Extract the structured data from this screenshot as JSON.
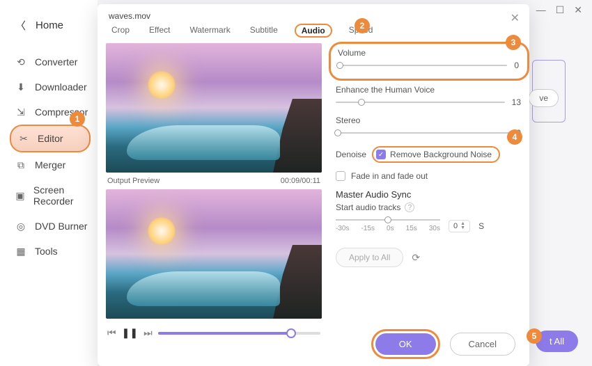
{
  "titlebar": {
    "min": "—",
    "max": "☐",
    "close": "✕"
  },
  "home_label": "Home",
  "sidebar": {
    "items": [
      {
        "label": "Converter"
      },
      {
        "label": "Downloader"
      },
      {
        "label": "Compressor"
      },
      {
        "label": "Editor"
      },
      {
        "label": "Merger"
      },
      {
        "label": "Screen Recorder"
      },
      {
        "label": "DVD Burner"
      },
      {
        "label": "Tools"
      }
    ]
  },
  "dialog": {
    "filename": "waves.mov",
    "tabs": [
      "Crop",
      "Effect",
      "Watermark",
      "Subtitle",
      "Audio",
      "Speed"
    ],
    "active_tab": "Audio",
    "preview_label": "Output Preview",
    "timecode": "00:09/00:11",
    "controls": {
      "volume_label": "Volume",
      "volume_value": "0",
      "enhance_label": "Enhance the Human Voice",
      "enhance_value": "13",
      "stereo_label": "Stereo",
      "stereo_value": "0",
      "denoise_label": "Denoise",
      "denoise_option": "Remove Background Noise",
      "fade_label": "Fade in and fade out",
      "sync_heading": "Master Audio Sync",
      "sync_sub": "Start audio tracks",
      "sync_ticks": [
        "-30s",
        "-15s",
        "0s",
        "15s",
        "30s"
      ],
      "sync_value": "0",
      "sync_unit": "S"
    },
    "apply_label": "Apply to All",
    "ok_label": "OK",
    "cancel_label": "Cancel"
  },
  "bg": {
    "btn": "t All",
    "save": "ve"
  },
  "badges": {
    "b1": "1",
    "b2": "2",
    "b3": "3",
    "b4": "4",
    "b5": "5"
  }
}
